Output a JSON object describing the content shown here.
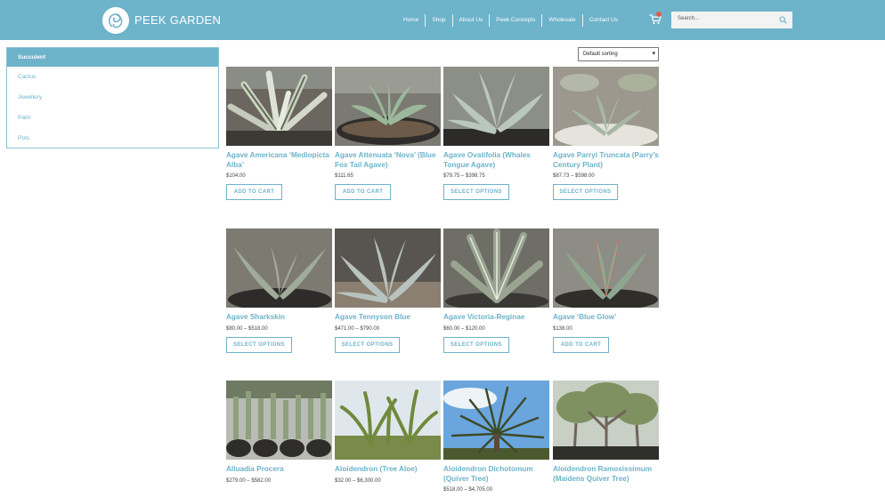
{
  "header": {
    "logo_text": "PEEK GARDEN",
    "nav": [
      "Home",
      "Shop",
      "About Us",
      "Peek Concepts",
      "Wholesale",
      "Contact Us"
    ],
    "search_placeholder": "Search..."
  },
  "sidebar": {
    "items": [
      "Succulent",
      "Cactus",
      "Jewellery",
      "Palm",
      "Pots"
    ],
    "active_index": 0
  },
  "sort": {
    "selected": "Default sorting"
  },
  "products": [
    {
      "title": "Agave Americana ‘Mediopicta Alba’",
      "price": "$104.00",
      "button": "ADD TO CART"
    },
    {
      "title": "Agave Attenuata ‘Nova’ (Blue Fox Tail Agave)",
      "price": "$111.65",
      "button": "ADD TO CART"
    },
    {
      "title": "Agave Ovatifolia (Whales Tongue Agave)",
      "price": "$79.75 – $398.75",
      "button": "SELECT OPTIONS"
    },
    {
      "title": "Agave Parryi Truncata (Parry’s Century Plant)",
      "price": "$87.73 – $598.00",
      "button": "SELECT OPTIONS"
    },
    {
      "title": "Agave Sharkskin",
      "price": "$80.00 – $518.00",
      "button": "SELECT OPTIONS"
    },
    {
      "title": "Agave Tennyson Blue",
      "price": "$471.00 – $790.00",
      "button": "SELECT OPTIONS"
    },
    {
      "title": "Agave Victoria-Reginae",
      "price": "$60.00 – $120.00",
      "button": "SELECT OPTIONS"
    },
    {
      "title": "Agave ‘Blue Glow’",
      "price": "$138.00",
      "button": "ADD TO CART"
    },
    {
      "title": "Alluadia Procera",
      "price": "$279.00 – $582.00",
      "button": ""
    },
    {
      "title": "Aloidendron (Tree Aloe)",
      "price": "$32.00 – $6,300.00",
      "button": ""
    },
    {
      "title": "Aloidendron Dichotomum (Quiver Tree)",
      "price": "$518.00 – $4,705.00",
      "button": ""
    },
    {
      "title": "Aloidendron Ramosissimum (Maidens Quiver Tree)",
      "price": "",
      "button": ""
    }
  ],
  "colors": {
    "brand": "#6db3ca",
    "cart_badge": "#e35a4a"
  }
}
